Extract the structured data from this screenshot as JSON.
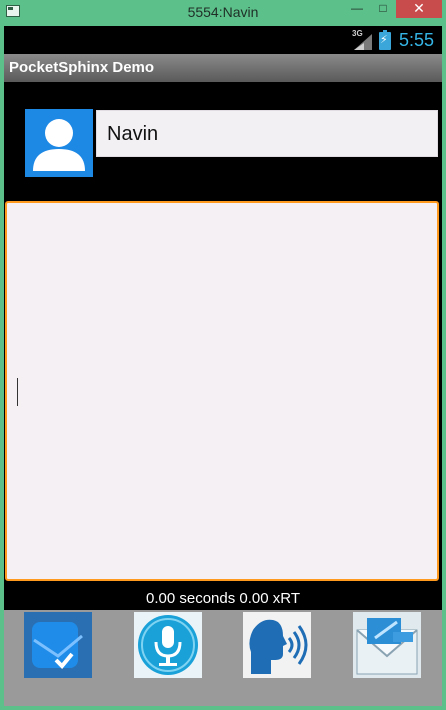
{
  "window": {
    "title": "5554:Navin",
    "minimize_glyph": "—",
    "maximize_glyph": "□",
    "close_glyph": "✕"
  },
  "status_bar": {
    "network": "3G",
    "time": "5:55"
  },
  "action_bar": {
    "title": "PocketSphinx Demo"
  },
  "profile": {
    "name": "Navin",
    "avatar_icon": "person-icon"
  },
  "recognition": {
    "text": "",
    "timing": "0.00 seconds 0.00 xRT"
  },
  "bottom_buttons": [
    {
      "icon": "checkbox-icon"
    },
    {
      "icon": "microphone-icon"
    },
    {
      "icon": "speaking-head-icon"
    },
    {
      "icon": "mail-icon"
    }
  ],
  "colors": {
    "title_bar": "#5cc08a",
    "clock": "#34b5e5",
    "text_border": "#ff9a1f",
    "avatar_bg": "#1e88e5"
  }
}
